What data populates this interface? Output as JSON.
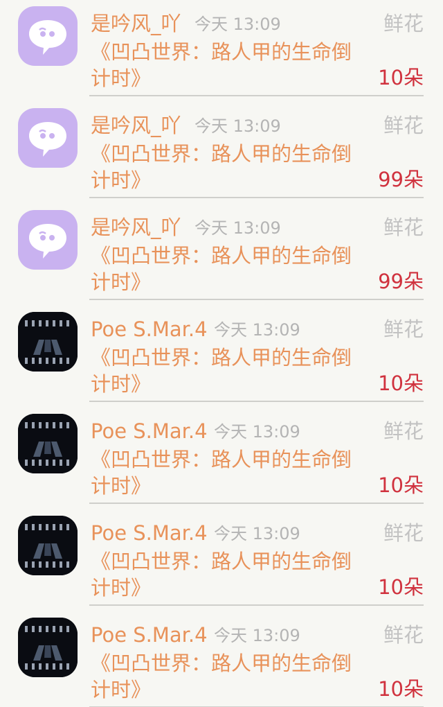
{
  "gift_list": {
    "items": [
      {
        "username": "是吟风_吖",
        "time": "今天 13:09",
        "gift": "鲜花",
        "title": "《凹凸世界：路人甲的生命倒计时》",
        "count": "10朵",
        "avatar": "chat-bubble-icon"
      },
      {
        "username": "是吟风_吖",
        "time": "今天 13:09",
        "gift": "鲜花",
        "title": "《凹凸世界：路人甲的生命倒计时》",
        "count": "99朵",
        "avatar": "chat-bubble-icon"
      },
      {
        "username": "是吟风_吖",
        "time": "今天 13:09",
        "gift": "鲜花",
        "title": "《凹凸世界：路人甲的生命倒计时》",
        "count": "99朵",
        "avatar": "chat-bubble-icon"
      },
      {
        "username": "Poe S.Mar.4",
        "time": "今天 13:09",
        "gift": "鲜花",
        "title": "《凹凸世界：路人甲的生命倒计时》",
        "count": "10朵",
        "avatar": "stage-photo"
      },
      {
        "username": "Poe S.Mar.4",
        "time": "今天 13:09",
        "gift": "鲜花",
        "title": "《凹凸世界：路人甲的生命倒计时》",
        "count": "10朵",
        "avatar": "stage-photo"
      },
      {
        "username": "Poe S.Mar.4",
        "time": "今天 13:09",
        "gift": "鲜花",
        "title": "《凹凸世界：路人甲的生命倒计时》",
        "count": "10朵",
        "avatar": "stage-photo"
      },
      {
        "username": "Poe S.Mar.4",
        "time": "今天 13:09",
        "gift": "鲜花",
        "title": "《凹凸世界：路人甲的生命倒计时》",
        "count": "10朵",
        "avatar": "stage-photo"
      }
    ]
  },
  "colors": {
    "background": "#f7f7f3",
    "username": "#e8925a",
    "title": "#e8925a",
    "time": "#b4b4b4",
    "gift": "#c2c2c2",
    "count": "#d0323e",
    "avatar_bubble_bg": "#c9b2f0"
  }
}
